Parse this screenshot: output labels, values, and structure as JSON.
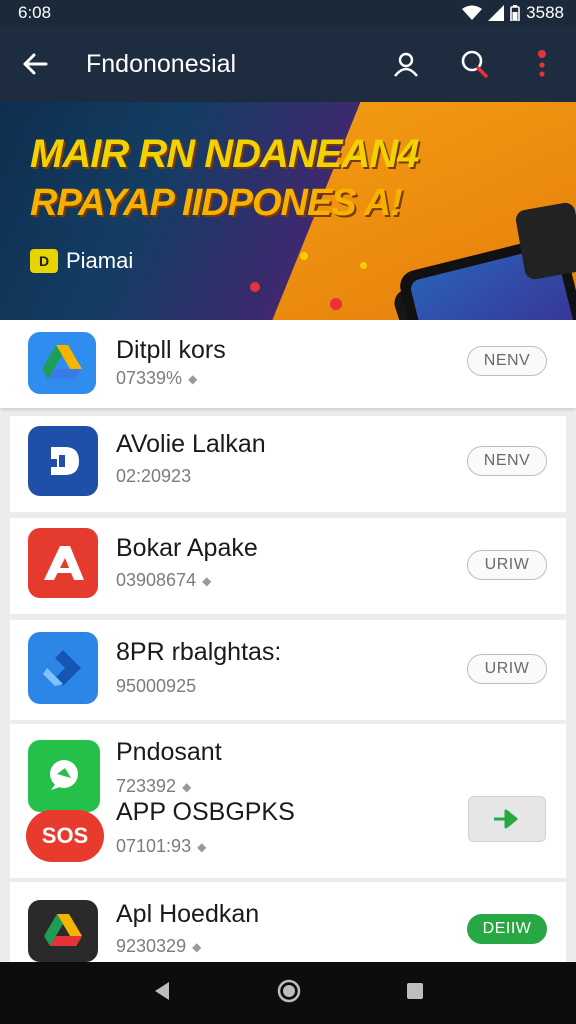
{
  "status": {
    "time": "6:08",
    "battery": "3588"
  },
  "appbar": {
    "title": "Fndononesial"
  },
  "banner": {
    "headline_1": "MAIR RN NDANEAN4",
    "headline_2": "RPAYAP IIDPONES A!",
    "brand_logo": "D",
    "brand_name": "Piamai",
    "colors": {
      "headline": "#f2d200",
      "orange": "#f29a12"
    }
  },
  "apps": [
    {
      "name": "Ditpll kors",
      "meta": "07339%",
      "action": "NENV",
      "icon": "google-drive-icon"
    },
    {
      "name": "AVolie Lalkan",
      "meta": "02:20923",
      "action": "NENV",
      "icon": "blue-d-icon"
    },
    {
      "name": "Bokar Apake",
      "meta": "03908674",
      "action": "URIW",
      "icon": "red-a-icon"
    },
    {
      "name": "8PR rbalghtas:",
      "meta": "95000925",
      "action": "URIW",
      "icon": "blue-arrow-icon"
    },
    {
      "name": "Pndosant",
      "meta": "723392",
      "icon": "green-chat-icon"
    },
    {
      "name": "APP OSBGPKS",
      "meta": "07101:93",
      "action_icon": "arrow-right-icon",
      "icon": "red-sos-icon"
    },
    {
      "name": "Apl Hoedkan",
      "meta": "9230329",
      "action": "DEIIW",
      "icon": "dark-drive-icon"
    }
  ]
}
